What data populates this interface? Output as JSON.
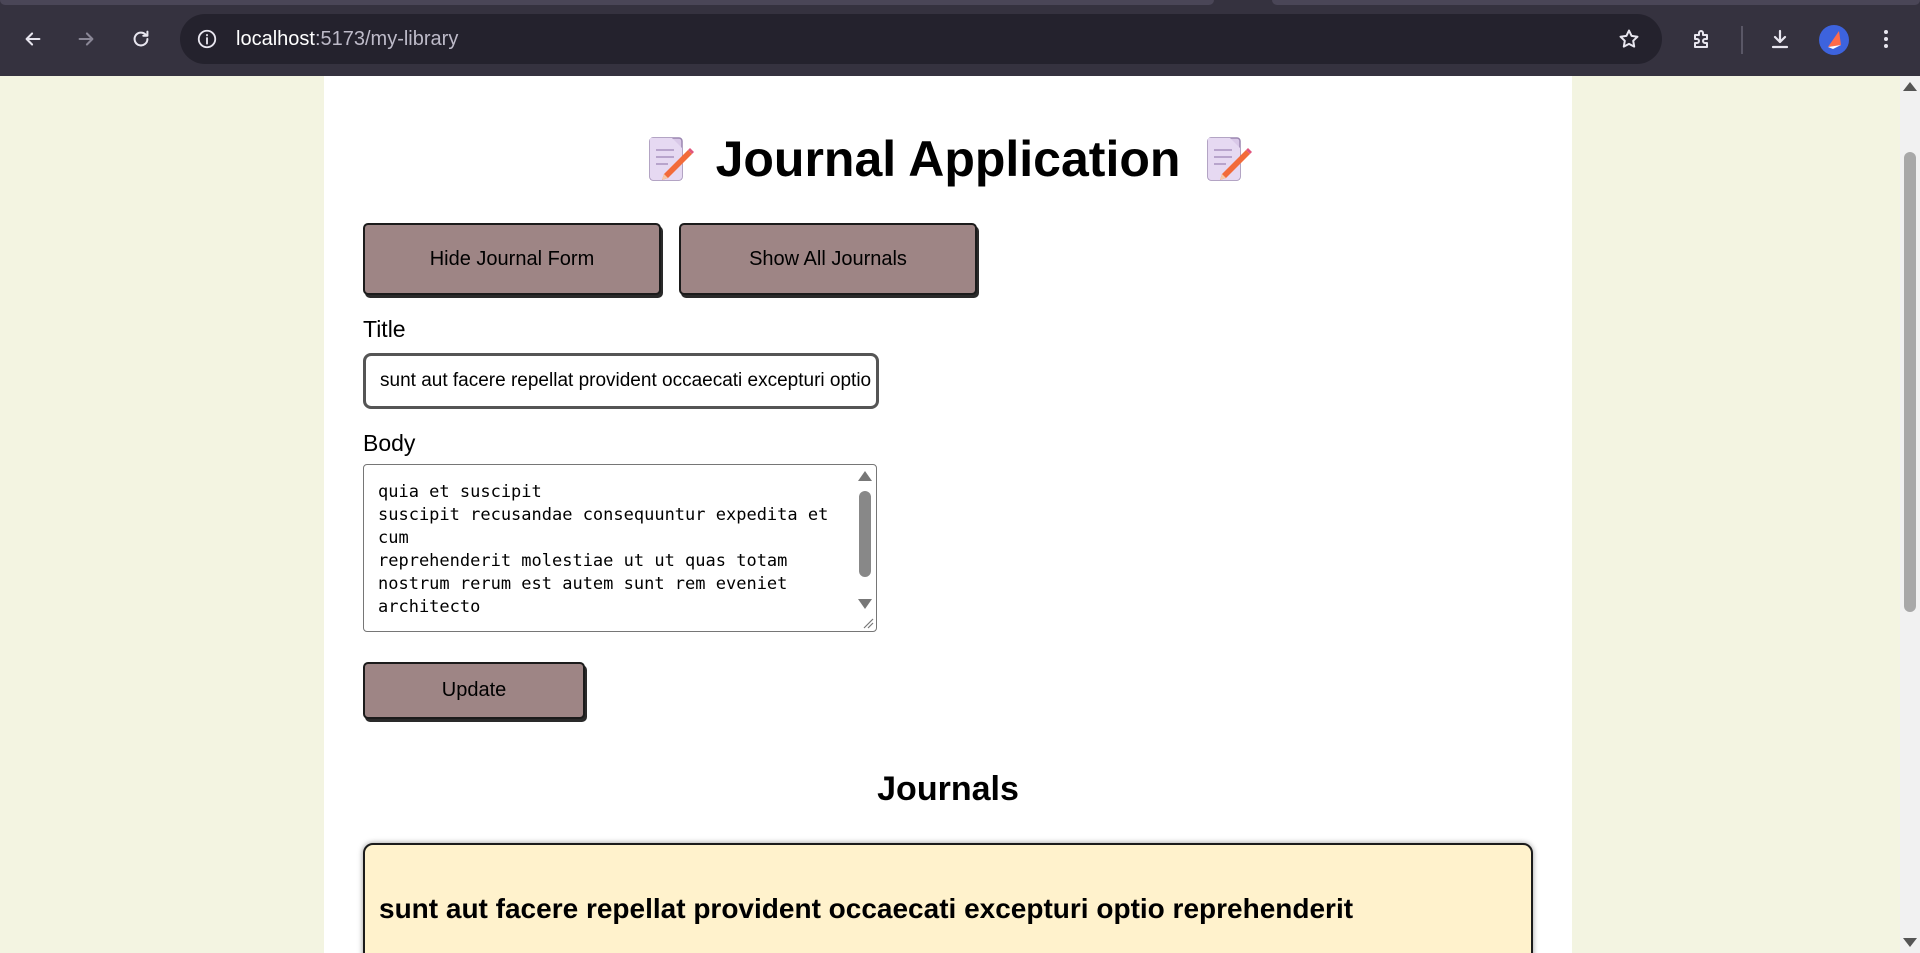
{
  "browser": {
    "url_host": "localhost",
    "url_rest": ":5173/my-library",
    "icons": [
      "back-arrow-icon",
      "forward-arrow-icon",
      "reload-icon",
      "site-info-icon",
      "star-bookmark-icon",
      "extensions-icon",
      "download-icon",
      "profile-avatar",
      "kebab-menu-icon"
    ]
  },
  "app": {
    "title": "Journal Application",
    "title_icon": "memo-emoji-icon",
    "buttons": {
      "hide_form": "Hide Journal Form",
      "show_all": "Show All Journals",
      "update": "Update"
    },
    "form": {
      "title_label": "Title",
      "title_value": "sunt aut facere repellat provident occaecati excepturi optio reprehenderit",
      "body_label": "Body",
      "body_value": "quia et suscipit\nsuscipit recusandae consequuntur expedita et cum\nreprehenderit molestiae ut ut quas totam\nnostrum rerum est autem sunt rem eveniet architecto"
    },
    "journals_heading": "Journals",
    "journals": [
      {
        "title": "sunt aut facere repellat provident occaecati excepturi optio reprehenderit"
      }
    ]
  },
  "colors": {
    "page_background": "#f3f4e1",
    "button_background": "#9e8585",
    "card_background": "#fff2cc",
    "browser_chrome": "#35323f"
  }
}
